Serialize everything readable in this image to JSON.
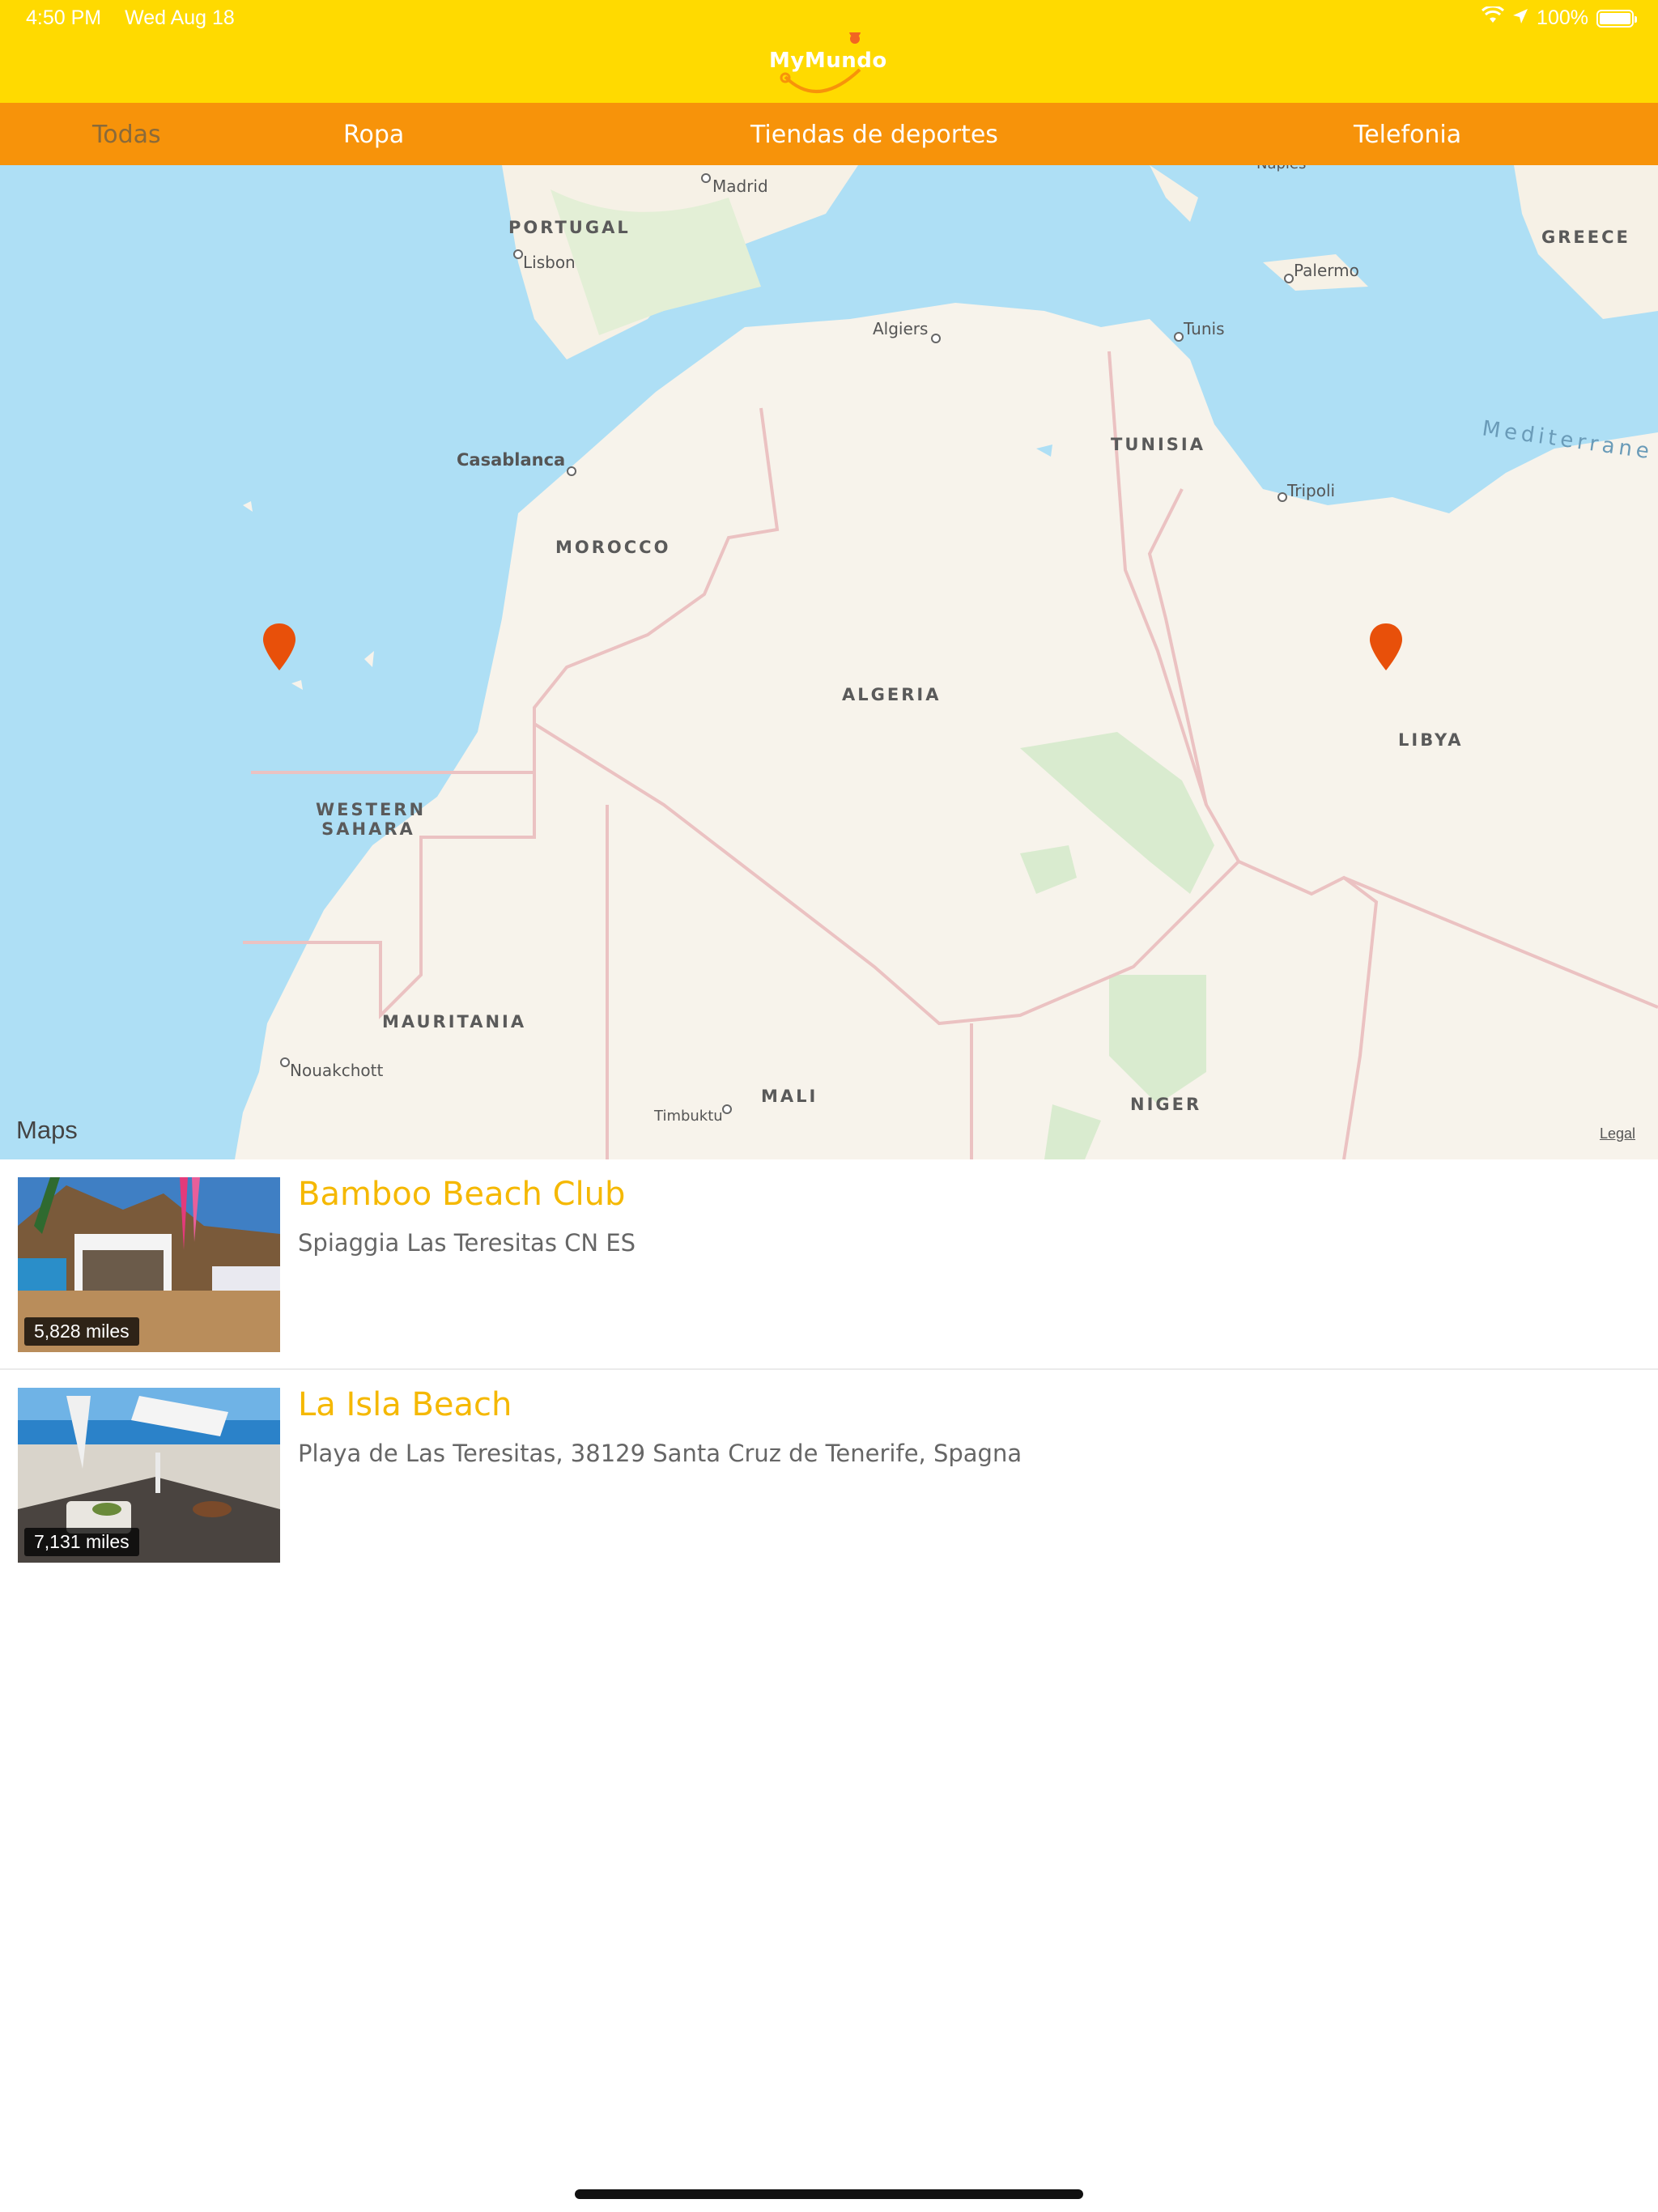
{
  "status_bar": {
    "time": "4:50 PM",
    "date": "Wed Aug 18",
    "battery": "100%"
  },
  "header": {
    "logo_text": "MyMundo",
    "brand_color": "#FFDA00"
  },
  "tabs": [
    {
      "label": "Todas",
      "active": true
    },
    {
      "label": "Ropa",
      "active": false
    },
    {
      "label": "Tiendas de deportes",
      "active": false
    },
    {
      "label": "Telefonia",
      "active": false
    }
  ],
  "map": {
    "countries": [
      "PORTUGAL",
      "GREECE",
      "TUNISIA",
      "MOROCCO",
      "ALGERIA",
      "LIBYA",
      "WESTERN SAHARA",
      "MAURITANIA",
      "MALI",
      "NIGER"
    ],
    "cities": [
      "Madrid",
      "Lisbon",
      "Palermo",
      "Naples",
      "Algiers",
      "Tunis",
      "Casablanca",
      "Tripoli",
      "Nouakchott",
      "Timbuktu"
    ],
    "sea": "Mediterrane",
    "brand": "Maps",
    "legal": "Legal",
    "pin_count": 2,
    "pin_color": "#E8500A"
  },
  "results": [
    {
      "title": "Bamboo Beach Club",
      "address": "Spiaggia Las Teresitas CN ES",
      "distance": "5,828 miles"
    },
    {
      "title": "La Isla Beach",
      "address": "Playa de Las Teresitas, 38129 Santa Cruz de Tenerife, Spagna",
      "distance": "7,131 miles"
    }
  ]
}
